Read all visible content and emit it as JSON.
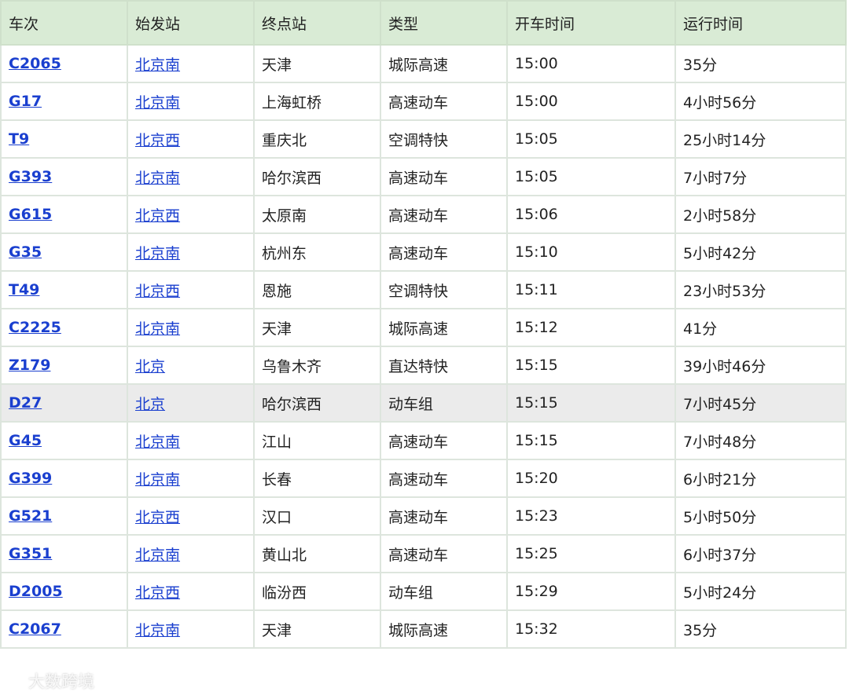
{
  "table": {
    "headers": [
      "车次",
      "始发站",
      "终点站",
      "类型",
      "开车时间",
      "运行时间"
    ],
    "rows": [
      {
        "train": "C2065",
        "from": "北京南",
        "to": "天津",
        "type": "城际高速",
        "depart": "15:00",
        "duration": "35分"
      },
      {
        "train": "G17",
        "from": "北京南",
        "to": "上海虹桥",
        "type": "高速动车",
        "depart": "15:00",
        "duration": "4小时56分"
      },
      {
        "train": "T9",
        "from": "北京西",
        "to": "重庆北",
        "type": "空调特快",
        "depart": "15:05",
        "duration": "25小时14分"
      },
      {
        "train": "G393",
        "from": "北京南",
        "to": "哈尔滨西",
        "type": "高速动车",
        "depart": "15:05",
        "duration": "7小时7分"
      },
      {
        "train": "G615",
        "from": "北京西",
        "to": "太原南",
        "type": "高速动车",
        "depart": "15:06",
        "duration": "2小时58分"
      },
      {
        "train": "G35",
        "from": "北京南",
        "to": "杭州东",
        "type": "高速动车",
        "depart": "15:10",
        "duration": "5小时42分"
      },
      {
        "train": "T49",
        "from": "北京西",
        "to": "恩施",
        "type": "空调特快",
        "depart": "15:11",
        "duration": "23小时53分"
      },
      {
        "train": "C2225",
        "from": "北京南",
        "to": "天津",
        "type": "城际高速",
        "depart": "15:12",
        "duration": "41分"
      },
      {
        "train": "Z179",
        "from": "北京",
        "to": "乌鲁木齐",
        "type": "直达特快",
        "depart": "15:15",
        "duration": "39小时46分"
      },
      {
        "train": "D27",
        "from": "北京",
        "to": "哈尔滨西",
        "type": "动车组",
        "depart": "15:15",
        "duration": "7小时45分"
      },
      {
        "train": "G45",
        "from": "北京南",
        "to": "江山",
        "type": "高速动车",
        "depart": "15:15",
        "duration": "7小时48分"
      },
      {
        "train": "G399",
        "from": "北京南",
        "to": "长春",
        "type": "高速动车",
        "depart": "15:20",
        "duration": "6小时21分"
      },
      {
        "train": "G521",
        "from": "北京西",
        "to": "汉口",
        "type": "高速动车",
        "depart": "15:23",
        "duration": "5小时50分"
      },
      {
        "train": "G351",
        "from": "北京南",
        "to": "黄山北",
        "type": "高速动车",
        "depart": "15:25",
        "duration": "6小时37分"
      },
      {
        "train": "D2005",
        "from": "北京西",
        "to": "临汾西",
        "type": "动车组",
        "depart": "15:29",
        "duration": "5小时24分"
      },
      {
        "train": "C2067",
        "from": "北京南",
        "to": "天津",
        "type": "城际高速",
        "depart": "15:32",
        "duration": "35分"
      }
    ]
  },
  "highlighted_train": "D27",
  "watermark": {
    "text": "大数跨境",
    "icon": "watermark-logo-icon"
  },
  "colors": {
    "header_bg": "#d9ebd5",
    "border": "#dde5dd",
    "link": "#1a3fcf",
    "highlight_row": "#ebebeb"
  }
}
